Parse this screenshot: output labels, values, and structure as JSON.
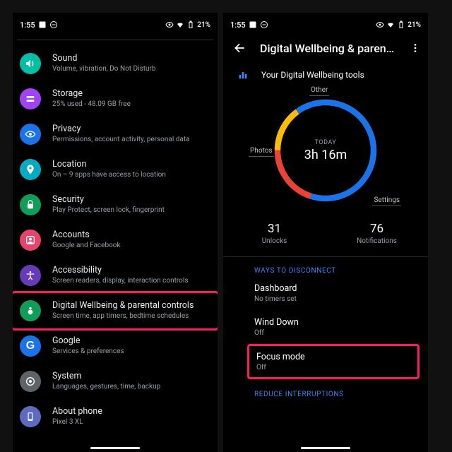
{
  "status": {
    "time": "1:55",
    "battery": "21%"
  },
  "left": {
    "items": [
      {
        "title": "Sound",
        "sub": "Volume, vibration, Do Not Disturb"
      },
      {
        "title": "Storage",
        "sub": "25% used - 48.09 GB free"
      },
      {
        "title": "Privacy",
        "sub": "Permissions, account activity, personal data"
      },
      {
        "title": "Location",
        "sub": "On – 9 apps have access to location"
      },
      {
        "title": "Security",
        "sub": "Play Protect, screen lock, fingerprint"
      },
      {
        "title": "Accounts",
        "sub": "Google and Facebook"
      },
      {
        "title": "Accessibility",
        "sub": "Screen readers, display, interaction controls"
      },
      {
        "title": "Digital Wellbeing & parental controls",
        "sub": "Screen time, app timers, bedtime schedules"
      },
      {
        "title": "Google",
        "sub": "Services & preferences"
      },
      {
        "title": "System",
        "sub": "Languages, gestures, time, backup"
      },
      {
        "title": "About phone",
        "sub": "Pixel 3 XL"
      }
    ]
  },
  "right": {
    "header": "Digital Wellbeing & parental c…",
    "tools": "Your Digital Wellbeing tools",
    "today_label": "TODAY",
    "today_value": "3h 16m",
    "seg_other": "Other",
    "seg_photos": "Photos",
    "seg_settings": "Settings",
    "unlocks_n": "31",
    "unlocks_l": "Unlocks",
    "notif_n": "76",
    "notif_l": "Notifications",
    "cat1": "Ways to disconnect",
    "cat2": "Reduce interruptions",
    "opts": [
      {
        "t": "Dashboard",
        "s": "No timers set"
      },
      {
        "t": "Wind Down",
        "s": "Off"
      },
      {
        "t": "Focus mode",
        "s": "Off"
      }
    ]
  },
  "chart_data": {
    "type": "pie",
    "title": "TODAY 3h 16m",
    "series": [
      {
        "name": "Other",
        "color": "#fbbc04",
        "fraction": 0.15
      },
      {
        "name": "Settings",
        "color": "#1a73e8",
        "fraction": 0.65
      },
      {
        "name": "Photos",
        "color": "#ea4335",
        "fraction": 0.2
      }
    ]
  }
}
